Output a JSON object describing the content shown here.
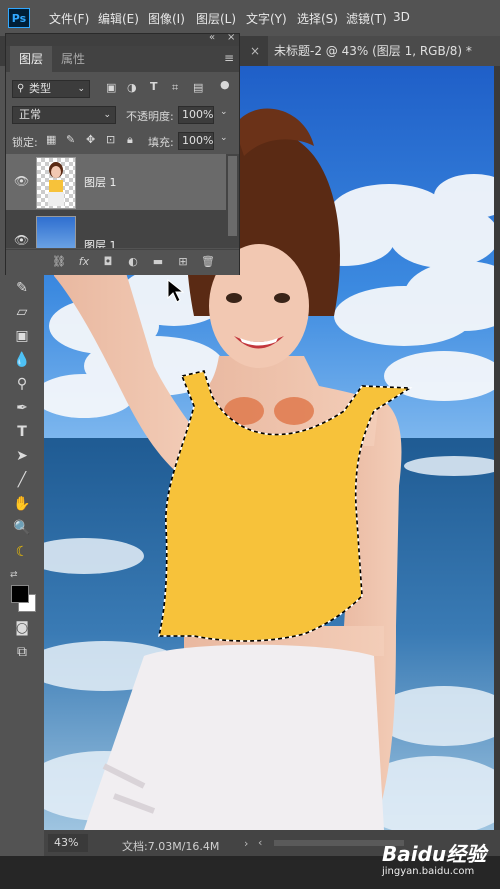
{
  "app": {
    "logo": "Ps"
  },
  "menu": [
    "文件(F)",
    "编辑(E)",
    "图像(I)",
    "图层(L)",
    "文字(Y)",
    "选择(S)",
    "滤镜(T)",
    "3D"
  ],
  "document": {
    "tab_title": "未标题-2 @ 43% (图层 1, RGB/8) *",
    "close_label": "×"
  },
  "panel": {
    "tabs": [
      "图层",
      "属性"
    ],
    "collapse_label": "«",
    "close_label": "×",
    "filter": {
      "kind": "类型"
    },
    "blend_mode": "正常",
    "opacity_label": "不透明度:",
    "opacity_value": "100%",
    "lock_label": "锁定:",
    "fill_label": "填充:",
    "fill_value": "100%",
    "layers": [
      {
        "name": "图层 1",
        "selected": true
      },
      {
        "name": "图层 1",
        "selected": false
      }
    ]
  },
  "status": {
    "zoom": "43%",
    "doc_info": "文档:7.03M/16.4M"
  },
  "watermark": {
    "brand": "Baidu经验",
    "url": "jingyan.baidu.com"
  },
  "colors": {
    "foreground": "#000000",
    "background": "#ffffff",
    "selection_top": "#f7c23a"
  },
  "icons": [
    "move-icon",
    "lasso-icon",
    "magic-wand-icon",
    "crop-icon",
    "eyedropper-icon",
    "healing-brush-icon",
    "brush-icon",
    "clone-stamp-icon",
    "history-brush-icon",
    "eraser-icon",
    "gradient-icon",
    "blur-icon",
    "dodge-icon",
    "pen-icon",
    "type-icon",
    "path-selection-icon",
    "line-icon",
    "hand-icon",
    "zoom-icon",
    "banana-icon",
    "quick-mask-icon",
    "screen-mode-icon"
  ]
}
